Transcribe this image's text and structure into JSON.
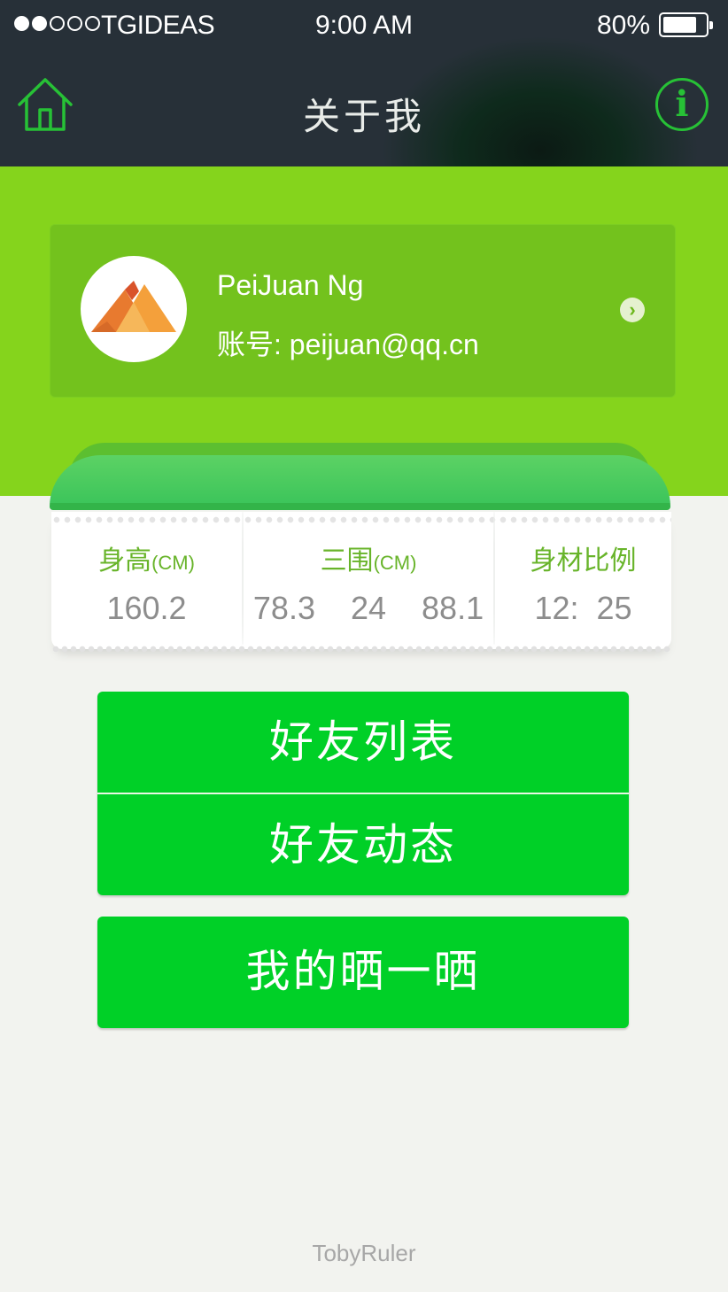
{
  "status_bar": {
    "carrier": "TGIDEAS",
    "time": "9:00 AM",
    "battery": "80%",
    "battery_level": 0.8,
    "signal_bars_filled": 2,
    "signal_bars_total": 5
  },
  "nav": {
    "title": "关于我",
    "left_icon": "home-icon",
    "right_icon": "info-icon",
    "info_glyph": "i"
  },
  "profile": {
    "name": "PeiJuan Ng",
    "account": "账号: peijuan@qq.cn",
    "avatar_icon": "mountain-avatar-icon",
    "chevron": "›"
  },
  "stats": [
    {
      "label": "身高",
      "unit": "(CM)",
      "value": "160.2"
    },
    {
      "label": "三围",
      "unit": "(CM)",
      "value": "78.3  24  88.1"
    },
    {
      "label": "身材比例",
      "unit": "",
      "value": "12: 25"
    }
  ],
  "buttons": {
    "friends_list": "好友列表",
    "friends_feed": "好友动态",
    "my_showcase": "我的晒一晒"
  },
  "footer": "TobyRuler",
  "colors": {
    "nav_bg": "#273038",
    "accent_green": "#85d41c",
    "button_green": "#00d027",
    "stat_label": "#68b42a"
  }
}
